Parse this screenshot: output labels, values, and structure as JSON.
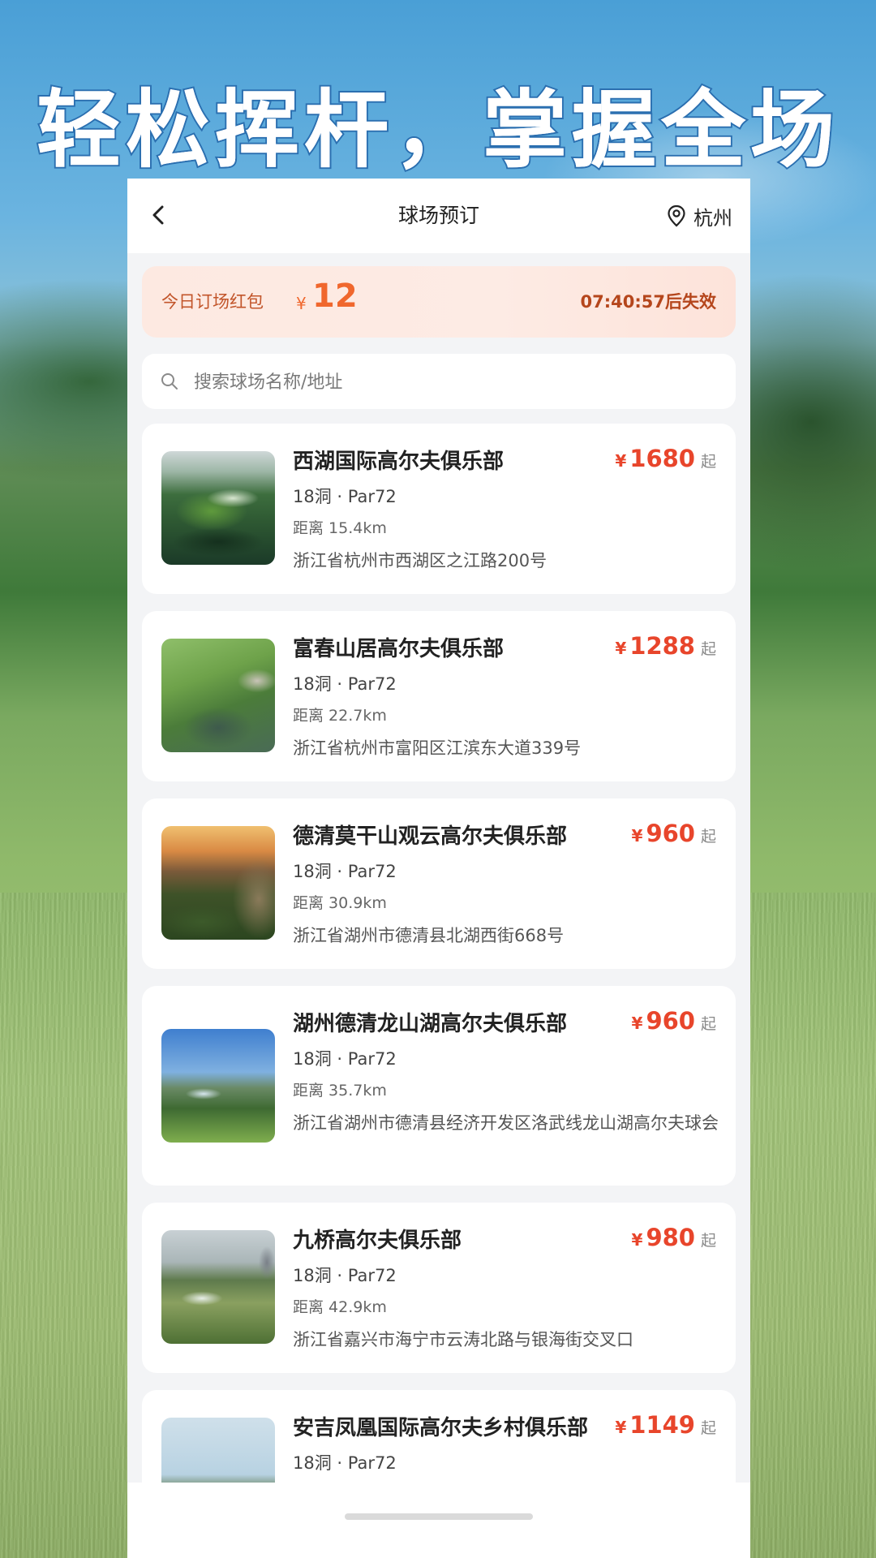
{
  "headline": "轻松挥杆，掌握全场",
  "header": {
    "title": "球场预订",
    "city": "杭州"
  },
  "promo": {
    "label": "今日订场红包",
    "currency": "¥",
    "amount": "12",
    "timer": "07:40:57后失效"
  },
  "search": {
    "placeholder": "搜索球场名称/地址"
  },
  "courses": [
    {
      "name": "西湖国际高尔夫俱乐部",
      "currency": "¥",
      "price": "1680",
      "price_suffix": "起",
      "meta": "18洞 · Par72",
      "distance": "距离 15.4km",
      "address": "浙江省杭州市西湖区之江路200号"
    },
    {
      "name": "富春山居高尔夫俱乐部",
      "currency": "¥",
      "price": "1288",
      "price_suffix": "起",
      "meta": "18洞 · Par72",
      "distance": "距离 22.7km",
      "address": "浙江省杭州市富阳区江滨东大道339号"
    },
    {
      "name": "德清莫干山观云高尔夫俱乐部",
      "currency": "¥",
      "price": "960",
      "price_suffix": "起",
      "meta": "18洞 · Par72",
      "distance": "距离 30.9km",
      "address": "浙江省湖州市德清县北湖西街668号"
    },
    {
      "name": "湖州德清龙山湖高尔夫俱乐部",
      "currency": "¥",
      "price": "960",
      "price_suffix": "起",
      "meta": "18洞 · Par72",
      "distance": "距离 35.7km",
      "address": "浙江省湖州市德清县经济开发区洛武线龙山湖高尔夫球会"
    },
    {
      "name": "九桥高尔夫俱乐部",
      "currency": "¥",
      "price": "980",
      "price_suffix": "起",
      "meta": "18洞 · Par72",
      "distance": "距离 42.9km",
      "address": "浙江省嘉兴市海宁市云涛北路与银海街交叉口"
    },
    {
      "name": "安吉凤凰国际高尔夫乡村俱乐部",
      "currency": "¥",
      "price": "1149",
      "price_suffix": "起",
      "meta": "18洞 · Par72",
      "distance": "",
      "address": ""
    }
  ],
  "colors": {
    "price_red": "#e8452b",
    "promo_orange": "#f0672d",
    "headline_stroke": "#2b6fb0"
  }
}
